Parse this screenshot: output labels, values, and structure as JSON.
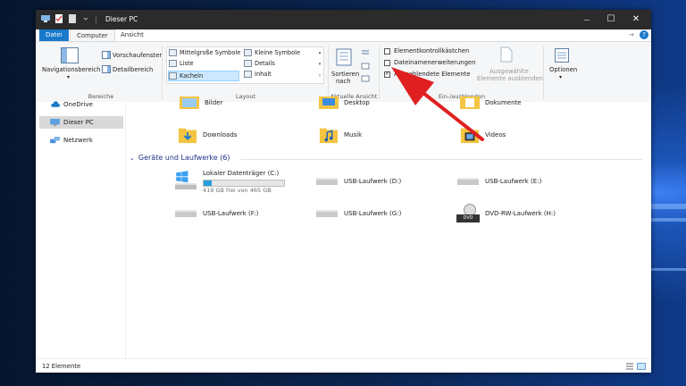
{
  "window": {
    "title": "Dieser PC",
    "title_sep": "|",
    "controls": {
      "minimize": "—",
      "maximize": "☐",
      "close": "✕"
    }
  },
  "tabs": {
    "file": "Datei",
    "computer": "Computer",
    "view": "Ansicht"
  },
  "ribbon_right": {
    "pin": "⇝",
    "help": "?"
  },
  "ribbon": {
    "panes": {
      "navigation": "Navigationsbereich",
      "preview": "Vorschaufenster",
      "details": "Detailbereich",
      "group": "Bereiche"
    },
    "layout": {
      "medium": "Mittelgroße Symbole",
      "small": "Kleine Symbole",
      "list": "Liste",
      "details": "Details",
      "tiles": "Kacheln",
      "content": "Inhalt",
      "group": "Layout"
    },
    "current_view": {
      "sort_line1": "Sortieren",
      "sort_line2": "nach",
      "group": "Aktuelle Ansicht"
    },
    "show_hide": {
      "item_checkboxes": "Elementkontrollkästchen",
      "file_extensions": "Dateinamenerweiterungen",
      "hidden_items": "Ausgeblendete Elemente",
      "hide_selected_line1": "Ausgewählte",
      "hide_selected_line2": "Elemente ausblenden",
      "group": "Ein-/ausblenden"
    },
    "options": "Optionen"
  },
  "nav": {
    "items": [
      {
        "label": "OneDrive"
      },
      {
        "label": "Dieser PC"
      },
      {
        "label": "Netzwerk"
      }
    ]
  },
  "folders": [
    {
      "label": "Bilder"
    },
    {
      "label": "Desktop"
    },
    {
      "label": "Dokumente"
    },
    {
      "label": "Downloads"
    },
    {
      "label": "Musik"
    },
    {
      "label": "Videos"
    }
  ],
  "devices": {
    "heading": "Geräte und Laufwerke (6)",
    "items": [
      {
        "label": "Lokaler Datenträger (C:)",
        "free": "419 GB frei von 465 GB",
        "used_fraction": 0.1
      },
      {
        "label": "USB-Laufwerk (D:)"
      },
      {
        "label": "USB-Laufwerk (E:)"
      },
      {
        "label": "USB-Laufwerk (F:)"
      },
      {
        "label": "USB-Laufwerk (G:)"
      },
      {
        "label": "DVD-RW-Laufwerk (H:)",
        "badge": "DVD"
      }
    ]
  },
  "status": {
    "count": "12 Elemente"
  },
  "colors": {
    "accent": "#1979ca",
    "arrow": "#e02020",
    "folder": "#f4c542"
  }
}
